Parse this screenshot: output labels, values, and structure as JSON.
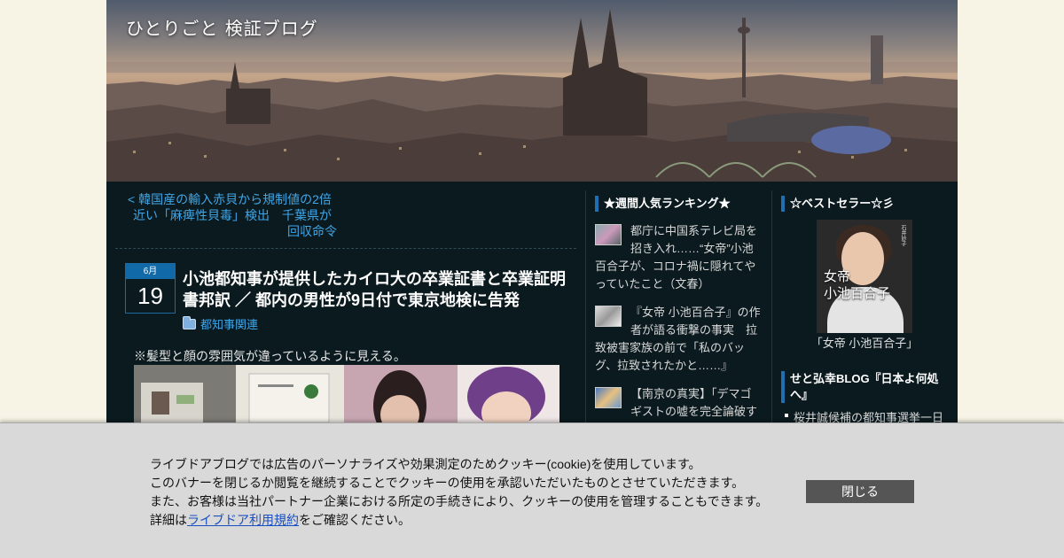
{
  "blog": {
    "title": "ひとりごと 検証ブログ"
  },
  "nav": {
    "prev_line1": "< 韓国産の輸入赤貝から規制値の2倍",
    "prev_line2": "近い「麻痺性貝毒」検出　千葉県が",
    "prev_line3": "回収命令"
  },
  "post": {
    "month": "6月",
    "day": "19",
    "title": "小池都知事が提供したカイロ大の卒業証書と卒業証明書邦訳 ／ 都内の男性が9日付で東京地検に告発",
    "category": "都知事関連",
    "note": "※髪型と顔の雰囲気が違っているように見える。"
  },
  "ranking": {
    "heading": "★週間人気ランキング★",
    "items": [
      {
        "text": "都庁に中国系テレビ局を招き入れ……“女帝”小池百合子が、コロナ禍に隠れてやっていたこと（文春）"
      },
      {
        "text": "『女帝 小池百合子』の作者が語る衝撃の事実　拉致被害家族の前で「私のバッグ、拉致されたかと……』"
      },
      {
        "text": "【南京の真実】「デマゴギストの嘘を完全論破する」　水島総＆松尾一郎　検"
      }
    ]
  },
  "bestseller": {
    "heading": "☆ベストセラー☆彡",
    "book_title": "女帝\n小池百合子",
    "book_author": "石井妙子",
    "caption": "「女帝 小池百合子」"
  },
  "seto_blog": {
    "heading": "せと弘幸BLOG『日本よ何処へ』",
    "item": "桜井誠候補の都知事選挙一日"
  },
  "cookie": {
    "line1": "ライブドアブログでは広告のパーソナライズや効果測定のためクッキー(cookie)を使用しています。",
    "line2": "このバナーを閉じるか閲覧を継続することでクッキーの使用を承認いただいたものとさせていただきます。",
    "line3": "また、お客様は当社パートナー企業における所定の手続きにより、クッキーの使用を管理することもできます。",
    "line4_pre": "詳細は",
    "line4_link": "ライブドア利用規約",
    "line4_post": "をご確認ください。",
    "close_label": "閉じる"
  }
}
